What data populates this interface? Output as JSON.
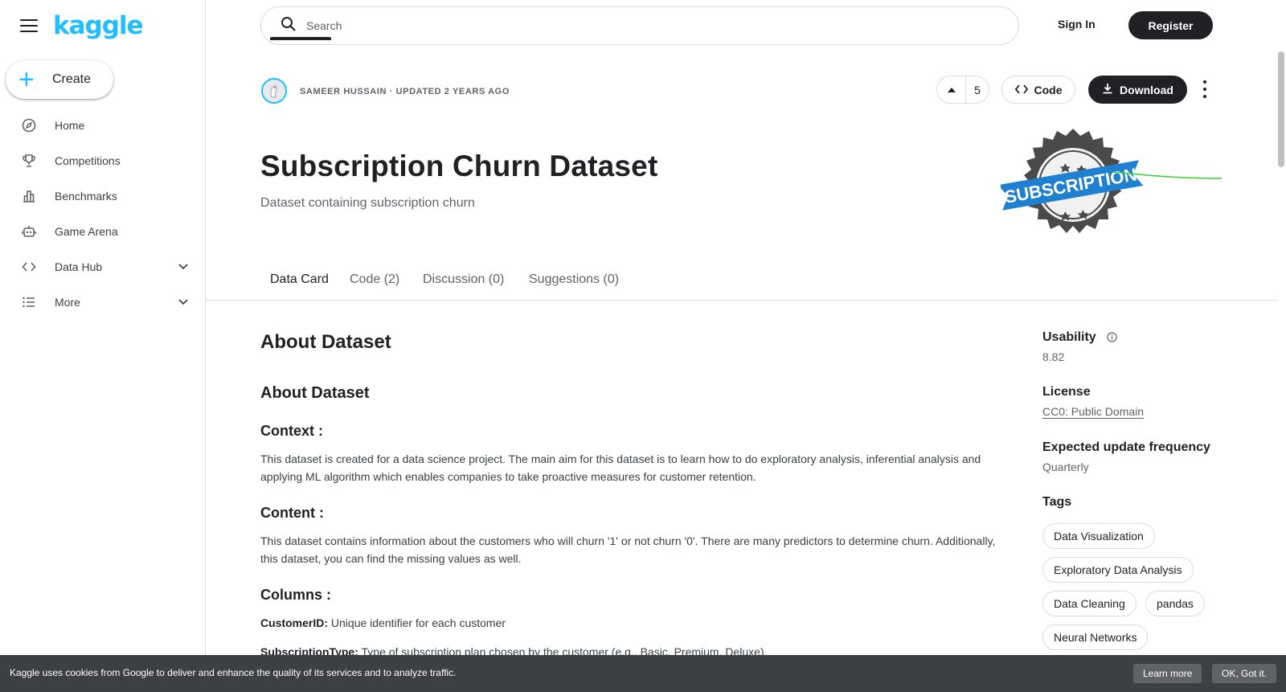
{
  "brand": {
    "logo": "kaggle",
    "accent": "#20beff"
  },
  "sidebar": {
    "create_label": "Create",
    "items": [
      {
        "label": "Home",
        "icon": "compass-icon"
      },
      {
        "label": "Competitions",
        "icon": "trophy-icon"
      },
      {
        "label": "Benchmarks",
        "icon": "bar-chart-icon"
      },
      {
        "label": "Game Arena",
        "icon": "robot-icon"
      },
      {
        "label": "Data Hub",
        "icon": "code-icon",
        "expandable": true
      },
      {
        "label": "More",
        "icon": "list-icon",
        "expandable": true
      }
    ]
  },
  "header": {
    "search_placeholder": "Search",
    "sign_in": "Sign In",
    "register": "Register"
  },
  "dataset": {
    "owner_meta": "SAMEER HUSSAIN · UPDATED 2 YEARS AGO",
    "votes": "5",
    "code_label": "Code",
    "download_label": "Download",
    "title": "Subscription Churn Dataset",
    "subtitle": "Dataset containing subscription churn",
    "thumbnail_text": "SUBSCRIPTION"
  },
  "tabs": [
    {
      "label": "Data Card",
      "active": true
    },
    {
      "label": "Code (2)"
    },
    {
      "label": "Discussion (0)"
    },
    {
      "label": "Suggestions (0)"
    }
  ],
  "content": {
    "heading1": "About Dataset",
    "heading2": "About Dataset",
    "context_heading": "Context :",
    "context_text": "This dataset is created for a data science project. The main aim for this dataset is to learn how to do exploratory analysis, inferential analysis and applying ML algorithm which enables companies to take proactive measures for customer retention.",
    "content_heading": "Content :",
    "content_text": "This dataset contains information about the customers who will churn '1' or not churn '0'. There are many predictors to determine churn. Additionally, this dataset, you can find the missing values as well.",
    "columns_heading": "Columns :",
    "columns": [
      {
        "name": "CustomerID:",
        "desc": "Unique identifier for each customer"
      },
      {
        "name": "SubscriptionType:",
        "desc": "Type of subscription plan chosen by the customer (e.g., Basic, Premium, Deluxe)"
      }
    ]
  },
  "side": {
    "usability_label": "Usability",
    "usability_value": "8.82",
    "license_label": "License",
    "license_value": "CC0: Public Domain",
    "frequency_label": "Expected update frequency",
    "frequency_value": "Quarterly",
    "tags_label": "Tags",
    "tags": [
      "Data Visualization",
      "Exploratory Data Analysis",
      "Data Cleaning",
      "pandas",
      "Neural Networks"
    ]
  },
  "cookie": {
    "text": "Kaggle uses cookies from Google to deliver and enhance the quality of its services and to analyze traffic.",
    "learn_more": "Learn more",
    "ok": "OK, Got it."
  }
}
